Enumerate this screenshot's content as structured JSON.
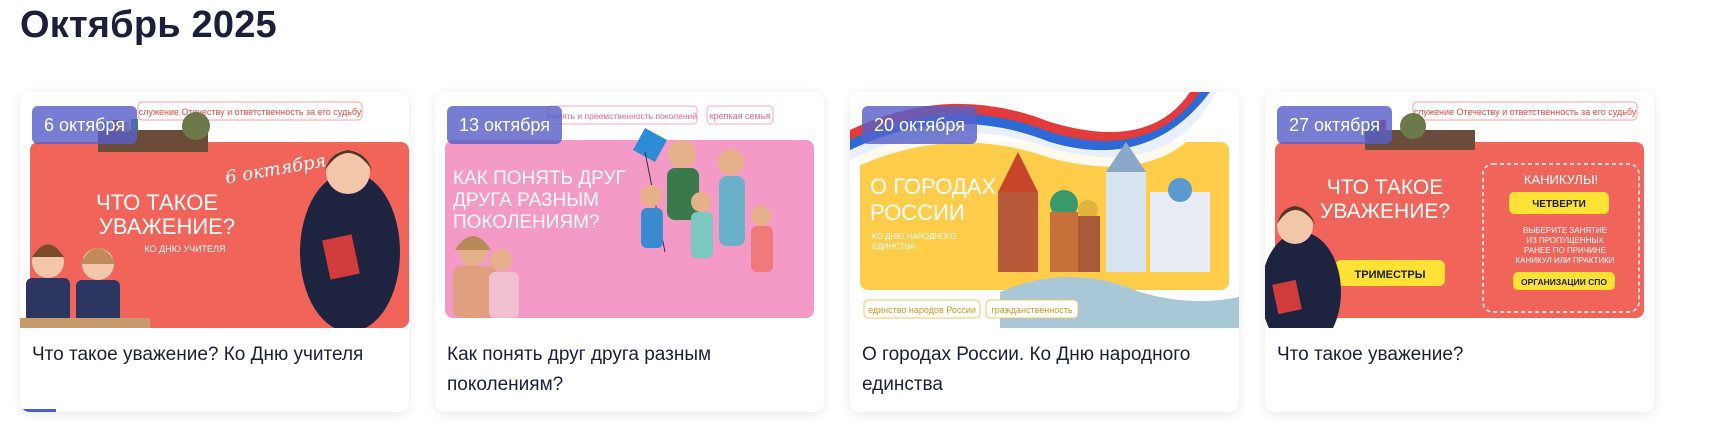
{
  "month_title": "Октябрь 2025",
  "cards": [
    {
      "date": "6 октября",
      "title": "Что такое уважение? Ко Дню учителя",
      "banner": {
        "tags": [
          "служение Отечеству и ответственность за его судьбу"
        ],
        "headline_1": "ЧТО ТАКОЕ",
        "headline_2": "УВАЖЕНИЕ?",
        "subline": "КО ДНЮ УЧИТЕЛЯ",
        "script": "6 октября",
        "bg": "#f0645a"
      }
    },
    {
      "date": "13 октября",
      "title": "Как понять друг друга разным поколениям?",
      "banner": {
        "tags": [
          "память и преемственность поколений",
          "крепкая семья"
        ],
        "headline_1": "КАК ПОНЯТЬ ДРУГ",
        "headline_2": "ДРУГА РАЗНЫМ",
        "headline_3": "ПОКОЛЕНИЯМ?",
        "bg": "#f49ac6"
      }
    },
    {
      "date": "20 октября",
      "title": "О городах России. Ко Дню народного единства",
      "banner": {
        "tags": [
          "единство народов России",
          "гражданственность"
        ],
        "headline_1": "О ГОРОДАХ",
        "headline_2": "РОССИИ",
        "subline_1": "КО ДНЮ НАРОДНОГО",
        "subline_2": "ЕДИНСТВА",
        "bg": "#ffcd4a"
      }
    },
    {
      "date": "27 октября",
      "title": "Что такое уважение?",
      "banner": {
        "tags": [
          "служение Отечеству и ответственность за его судьбу"
        ],
        "headline_1": "ЧТО ТАКОЕ",
        "headline_2": "УВАЖЕНИЕ?",
        "box_title": "КАНИКУЛЫ!",
        "chip_1": "ЧЕТВЕРТИ",
        "chip_2": "ТРИМЕСТРЫ",
        "box_text_1": "ВЫБЕРИТЕ ЗАНЯТИЕ",
        "box_text_2": "ИЗ ПРОПУЩЕННЫХ",
        "box_text_3": "РАНЕЕ ПО ПРИЧИНЕ",
        "box_text_4": "КАНИКУЛ ИЛИ ПРАКТИКИ",
        "chip_3": "ОРГАНИЗАЦИИ СПО",
        "bg": "#f0645a"
      }
    }
  ],
  "colors": {
    "badge": "#5860c8",
    "title_text": "#1b1f3b",
    "progress": "#4d5bd0"
  }
}
